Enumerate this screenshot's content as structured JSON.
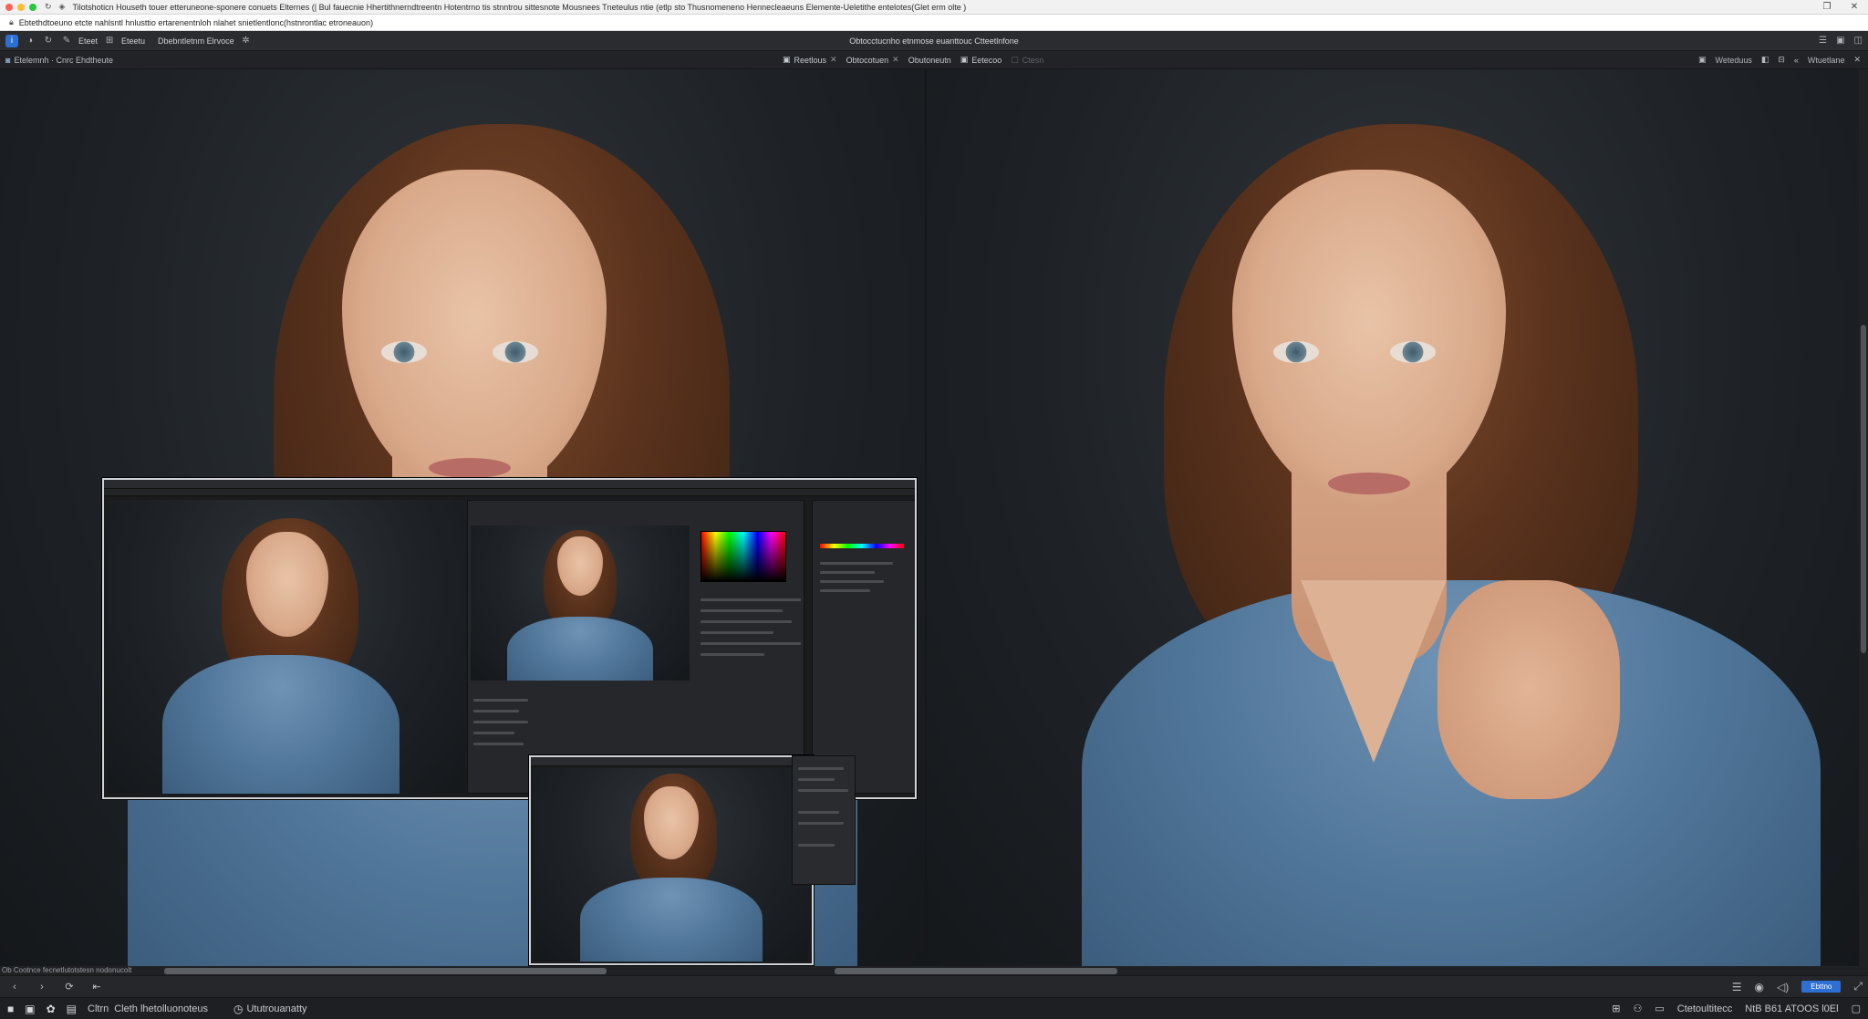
{
  "window": {
    "title": "Tilotshoticn Houseth touer etteruneone-sponere conuets Elternes (| Bul fauecnie Hhertithnerndtreentn Hotentrno tis stnntrou sittesnote Mousnees Tneteulus ntie (etlp sto Thusnomeneno Hennecleaeuns Elemente-Ueletithe entelotes(Glet erm olte )",
    "url": "Ebtethdtoeuno etcte nahlsntl hnlusttio ertarenentnloh nlahet snietlentlonc(hstnrontlac etroneauon)"
  },
  "app": {
    "menus": [
      "Eteet",
      "Eteetu",
      "Dbebntletnm Elrvoce"
    ],
    "document_title": "Obtocctucnho etnmose euanttouc Ctteetlnfone",
    "left_label": "Etelemnh · Cnrc Ehdtheute"
  },
  "tabs": [
    {
      "label": "Reetlous",
      "faint": false
    },
    {
      "label": "Obtocotuen",
      "faint": false
    },
    {
      "label": "Obutoneutn",
      "faint": false
    },
    {
      "label": "Eetecoo",
      "faint": false
    },
    {
      "label": "Ctesn",
      "faint": true
    }
  ],
  "toolbar_right": {
    "view_label": "Weteduus",
    "view2_label": "Wtuetlane"
  },
  "scroll": {
    "label": "Ob Cootnce fecnetlutotstesn nodonucolt"
  },
  "playbar": {
    "primary_label": "Ebttno"
  },
  "status": {
    "items": [
      "Cltrn",
      "Cleth lhetolluonoteus",
      "Ututrouanatty"
    ],
    "right_label": "Ctetoultitecc",
    "right_value": "NtB  B61  ATOOS l0El"
  },
  "icons": {
    "back": "back-icon",
    "forward": "forward-icon",
    "refresh": "refresh-icon",
    "skip": "skip-icon"
  },
  "colors": {
    "accent": "#2e6fd4",
    "background": "#1b1e22"
  }
}
